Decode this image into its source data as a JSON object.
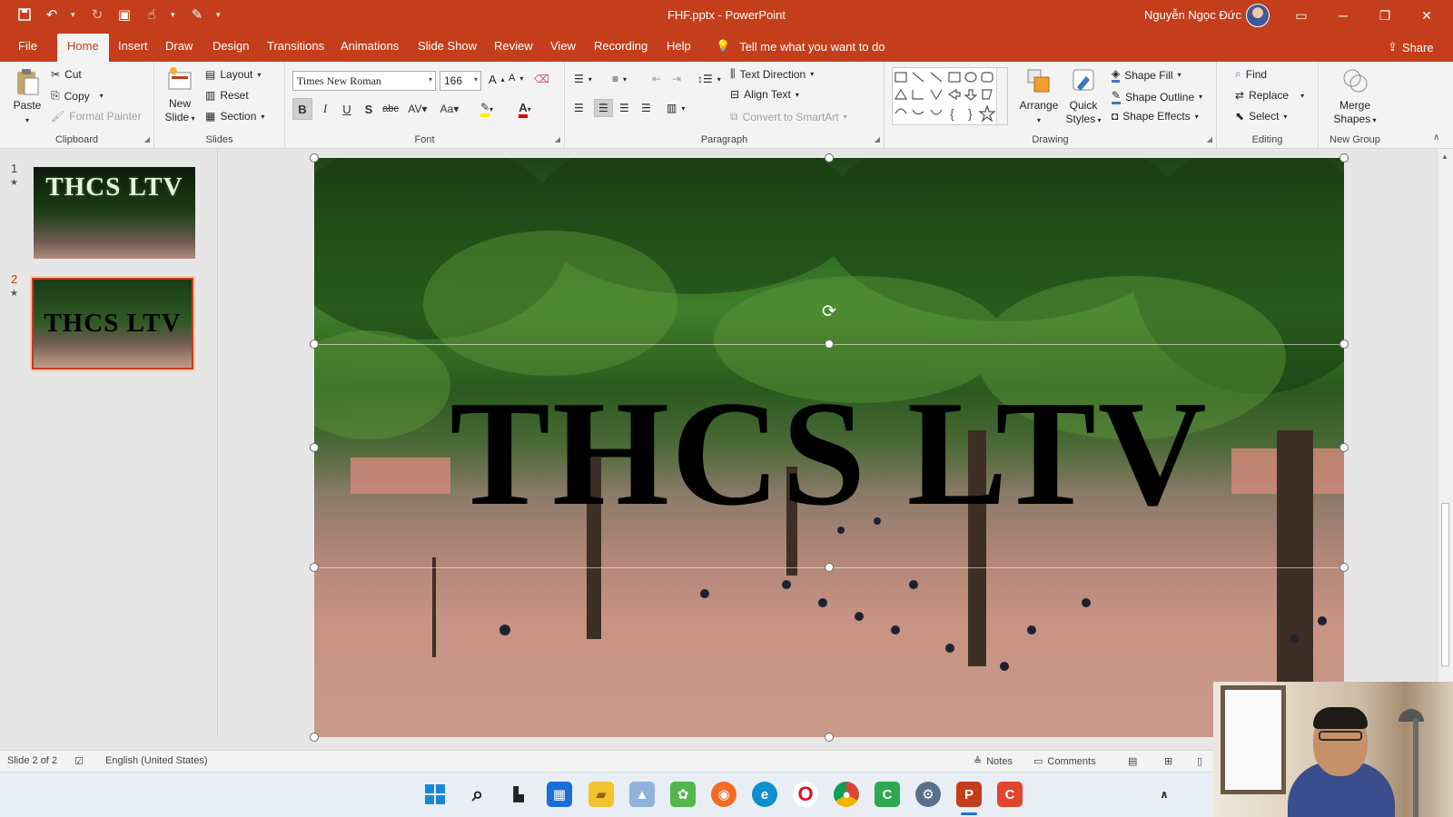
{
  "window": {
    "title": "FHF.pptx  -  PowerPoint",
    "user": "Nguyễn Ngọc Đức"
  },
  "tabs": [
    "File",
    "Home",
    "Insert",
    "Draw",
    "Design",
    "Transitions",
    "Animations",
    "Slide Show",
    "Review",
    "View",
    "Recording",
    "Help"
  ],
  "active_tab": "Home",
  "tell_me": "Tell me what you want to do",
  "share": "Share",
  "ribbon": {
    "clipboard": {
      "label": "Clipboard",
      "paste": "Paste",
      "cut": "Cut",
      "copy": "Copy",
      "format_painter": "Format Painter"
    },
    "slides": {
      "label": "Slides",
      "new_slide_1": "New",
      "new_slide_2": "Slide",
      "layout": "Layout",
      "reset": "Reset",
      "section": "Section"
    },
    "font": {
      "label": "Font",
      "family": "Times New Roman",
      "size": "166"
    },
    "paragraph": {
      "label": "Paragraph",
      "text_direction": "Text Direction",
      "align_text": "Align Text",
      "smartart": "Convert to SmartArt"
    },
    "drawing": {
      "label": "Drawing",
      "arrange": "Arrange",
      "quick_styles_1": "Quick",
      "quick_styles_2": "Styles",
      "shape_fill": "Shape Fill",
      "shape_outline": "Shape Outline",
      "shape_effects": "Shape Effects"
    },
    "editing": {
      "label": "Editing",
      "find": "Find",
      "replace": "Replace",
      "select": "Select"
    },
    "new_group": {
      "label": "New Group",
      "merge_1": "Merge",
      "merge_2": "Shapes"
    }
  },
  "slides": [
    {
      "number": "1",
      "text": "THCS LTV"
    },
    {
      "number": "2",
      "text": "THCS LTV"
    }
  ],
  "current_slide": {
    "text": "THCS LTV"
  },
  "status": {
    "slide_info": "Slide 2 of 2",
    "language": "English (United States)",
    "notes": "Notes",
    "comments": "Comments"
  },
  "colors": {
    "accent": "#c43e1c",
    "ribbon_bg": "#f3f3f3"
  },
  "taskbar_icons": [
    "windows-start",
    "search",
    "task-view",
    "widgets",
    "file-explorer",
    "photos",
    "paint",
    "firefox",
    "edge",
    "opera",
    "chrome",
    "camtasia",
    "settings",
    "powerpoint",
    "recorder"
  ]
}
